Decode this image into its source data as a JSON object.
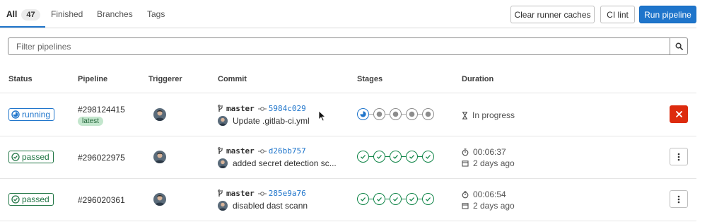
{
  "tabs": [
    {
      "label": "All",
      "count": "47",
      "active": true
    },
    {
      "label": "Finished"
    },
    {
      "label": "Branches"
    },
    {
      "label": "Tags"
    }
  ],
  "actions": {
    "clear_runner_caches": "Clear runner caches",
    "ci_lint": "CI lint",
    "run_pipeline": "Run pipeline"
  },
  "filter": {
    "placeholder": "Filter pipelines",
    "search_icon": "search-icon"
  },
  "columns": {
    "status": "Status",
    "pipeline": "Pipeline",
    "triggerer": "Triggerer",
    "commit": "Commit",
    "stages": "Stages",
    "duration": "Duration"
  },
  "rows": [
    {
      "status": "running",
      "pipeline_id": "#298124415",
      "tag": "latest",
      "branch": "master",
      "sha": "5984c029",
      "message": "Update .gitlab-ci.yml",
      "stages": [
        "running",
        "pending",
        "pending",
        "pending",
        "pending"
      ],
      "duration": "In progress",
      "action": "cancel"
    },
    {
      "status": "passed",
      "pipeline_id": "#296022975",
      "branch": "master",
      "sha": "d26bb757",
      "message": "added secret detection sc...",
      "stages": [
        "passed",
        "passed",
        "passed",
        "passed",
        "passed"
      ],
      "duration": "00:06:37",
      "finished": "2 days ago",
      "action": "more"
    },
    {
      "status": "passed",
      "pipeline_id": "#296020361",
      "branch": "master",
      "sha": "285e9a76",
      "message": "disabled dast scann",
      "stages": [
        "passed",
        "passed",
        "passed",
        "passed",
        "passed"
      ],
      "duration": "00:06:54",
      "finished": "2 days ago",
      "action": "more"
    }
  ],
  "colors": {
    "primary": "#1f75cb",
    "success": "#108548",
    "danger": "#dd2b0e",
    "latest_bg": "#c3e6cd"
  }
}
